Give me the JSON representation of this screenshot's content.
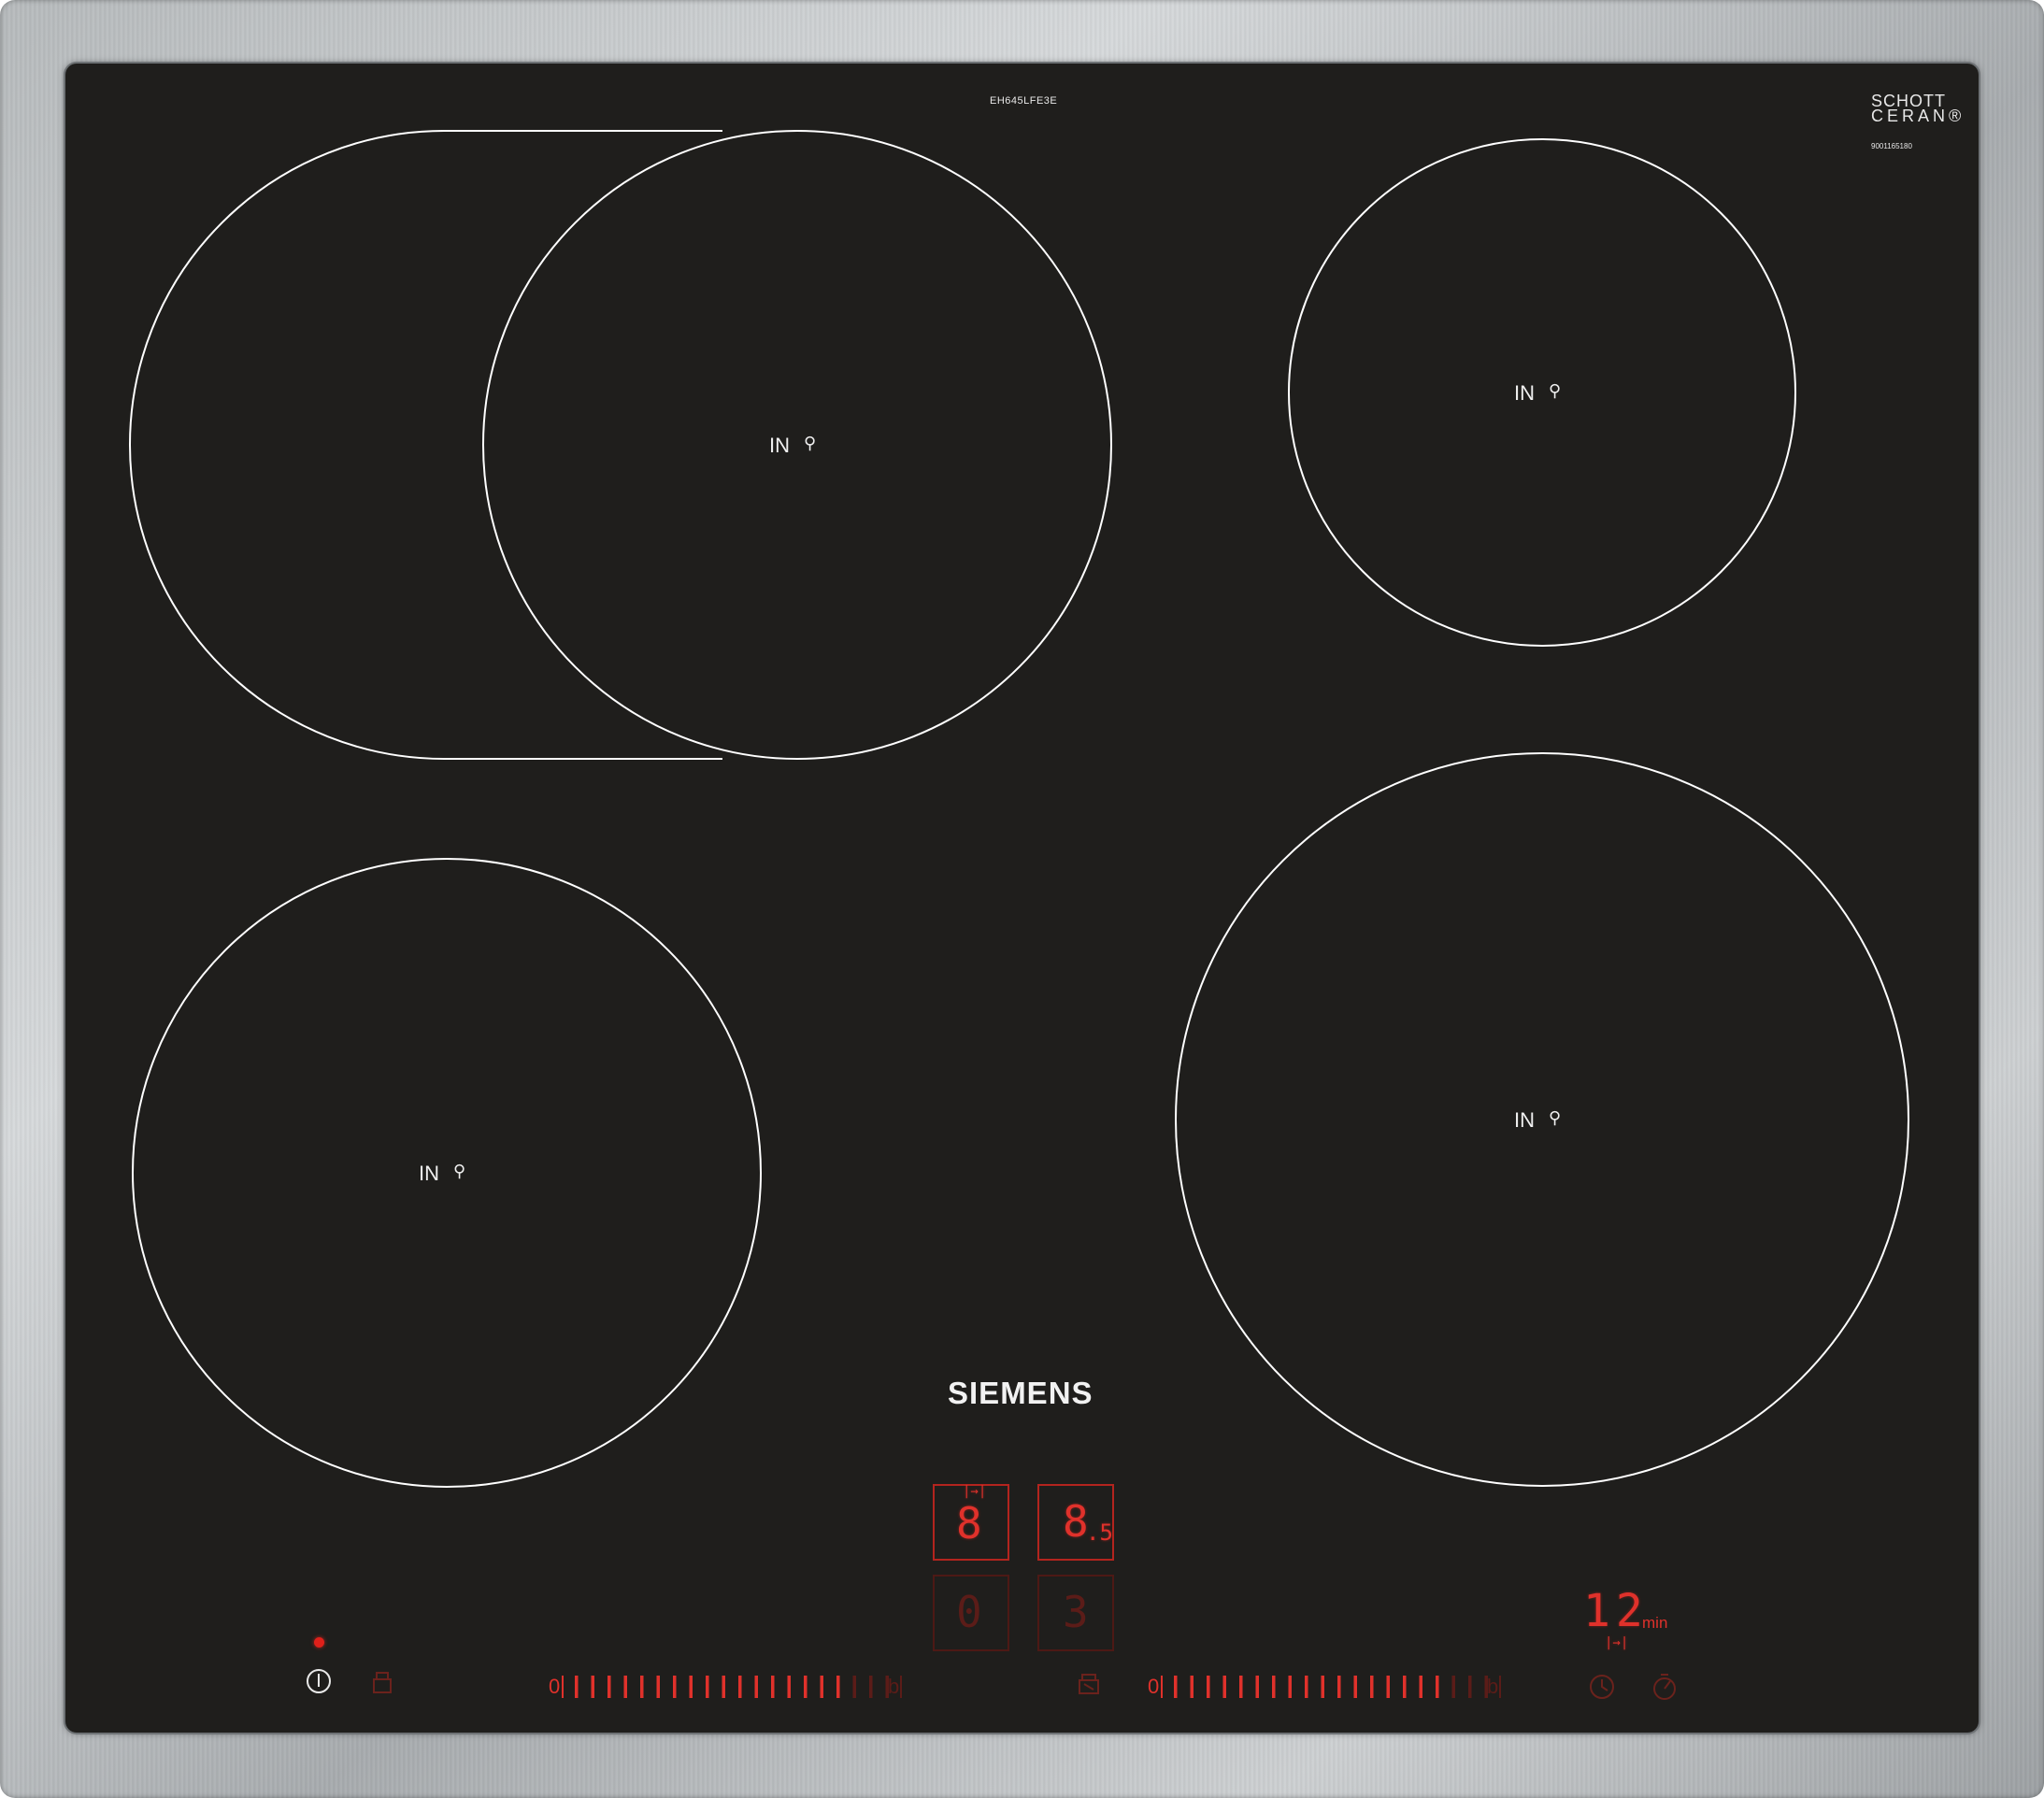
{
  "hob": {
    "model": "EH645LFE3E",
    "glass_brand_line1": "SCHOTT",
    "glass_brand_line2": "CERAN®",
    "serial": "9001165180",
    "brand": "SIEMENS"
  },
  "zones": [
    {
      "id": "front-left-flex",
      "label": "IN",
      "icon": "pan-icon"
    },
    {
      "id": "back-right",
      "label": "IN",
      "icon": "pan-icon"
    },
    {
      "id": "front-left",
      "label": "IN",
      "icon": "pan-icon"
    },
    {
      "id": "front-right",
      "label": "IN",
      "icon": "pan-icon"
    }
  ],
  "displays": {
    "zone_top_left": {
      "value": "8",
      "symbol": "|→|"
    },
    "zone_top_right": {
      "value": "8",
      "decimal": ".5"
    },
    "zone_bottom_left": {
      "value": "0"
    },
    "zone_bottom_right": {
      "value": "3"
    },
    "timer": {
      "value": "12",
      "unit": "min",
      "symbol": "|→|"
    }
  },
  "sliders": [
    {
      "id": "left-slider",
      "start": "0",
      "end": "b",
      "level_fraction": 0.85
    },
    {
      "id": "right-slider",
      "start": "0",
      "end": "b",
      "level_fraction": 0.85
    }
  ],
  "icons": [
    "power-icon",
    "child-lock-icon",
    "wipe-protection-icon",
    "timer-icon",
    "stopwatch-icon"
  ],
  "colors": {
    "glass": "#1f1e1c",
    "frame": "#c0c3c5",
    "display_red": "#e0312b",
    "zone_outline": "#ffffff"
  }
}
